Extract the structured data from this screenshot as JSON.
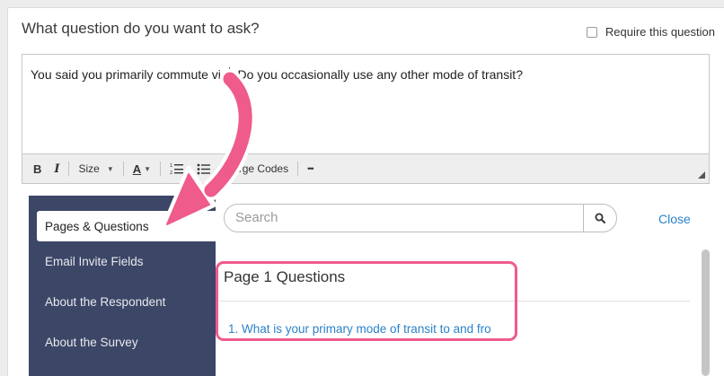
{
  "question": {
    "heading": "What question do you want to ask?",
    "require_label": "Require this question",
    "require_checked": false,
    "text_before_cursor": "You said you primarily commute via",
    "text_after_cursor": ". Do you occasionally use any other mode of transit?"
  },
  "toolbar": {
    "bold": "B",
    "italic": "I",
    "size": "Size",
    "font_color": "A",
    "merge_codes": "Merge Codes",
    "more": "•••"
  },
  "sidebar": {
    "items": [
      {
        "label": "Pages & Questions",
        "active": true
      },
      {
        "label": "Email Invite Fields",
        "active": false
      },
      {
        "label": "About the Respondent",
        "active": false
      },
      {
        "label": "About the Survey",
        "active": false
      }
    ]
  },
  "search": {
    "placeholder": "Search",
    "close_label": "Close"
  },
  "questions": {
    "page_title": "Page 1 Questions",
    "items": [
      "1. What is your primary mode of transit to and fro"
    ]
  },
  "colors": {
    "sidebar_bg": "#3c4666",
    "link": "#2b82c9",
    "highlight": "#ef5b8a"
  }
}
